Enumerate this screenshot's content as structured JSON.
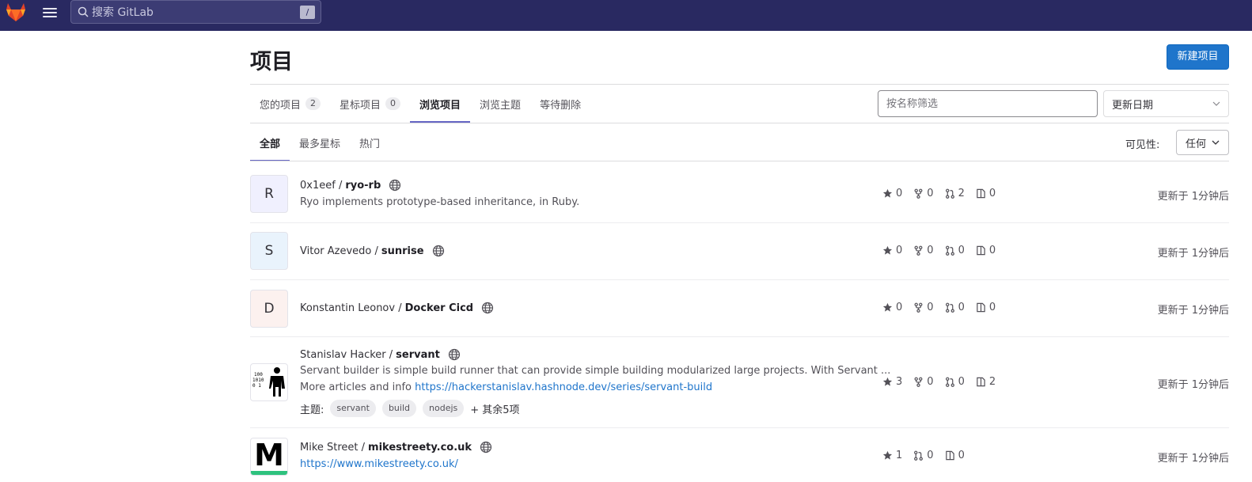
{
  "header": {
    "search_placeholder": "搜索 GitLab",
    "search_shortcut": "/"
  },
  "page": {
    "title": "项目",
    "new_project_label": "新建项目"
  },
  "tabs": [
    {
      "label": "您的项目",
      "count": "2"
    },
    {
      "label": "星标项目",
      "count": "0"
    },
    {
      "label": "浏览项目"
    },
    {
      "label": "浏览主题"
    },
    {
      "label": "等待删除"
    }
  ],
  "filter": {
    "placeholder": "按名称筛选",
    "sort_label": "更新日期"
  },
  "subtabs": [
    "全部",
    "最多星标",
    "热门"
  ],
  "visibility": {
    "label": "可见性:",
    "value": "任何"
  },
  "projects": [
    {
      "avatar": "R",
      "namespace": "0x1eef /",
      "name": "ryo-rb",
      "description": "Ryo implements prototype-based inheritance, in Ruby.",
      "stars": "0",
      "forks": "0",
      "mrs": "2",
      "issues": "0",
      "updated": "更新于 1分钟后"
    },
    {
      "avatar": "S",
      "namespace": "Vitor Azevedo /",
      "name": "sunrise",
      "stars": "0",
      "forks": "0",
      "mrs": "0",
      "issues": "0",
      "updated": "更新于 1分钟后"
    },
    {
      "avatar": "D",
      "namespace": "Konstantin Leonov /",
      "name": "Docker Cicd",
      "stars": "0",
      "forks": "0",
      "mrs": "0",
      "issues": "0",
      "updated": "更新于 1分钟后"
    },
    {
      "namespace": "Stanislav Hacker /",
      "name": "servant",
      "description": "Servant builder is simple build runner that can provide simple building modularized large projects. With Servant ...",
      "desc_more_prefix": "More articles and info",
      "desc_link": "https://hackerstanislav.hashnode.dev/series/servant-build",
      "topics_label": "主题:",
      "topics": [
        "servant",
        "build",
        "nodejs"
      ],
      "topics_more": "+ 其余5项",
      "stars": "3",
      "forks": "0",
      "mrs": "0",
      "issues": "2",
      "updated": "更新于 1分钟后"
    },
    {
      "avatar": "M",
      "namespace": "Mike Street /",
      "name": "mikestreety.co.uk",
      "desc_link": "https://www.mikestreety.co.uk/",
      "stars": "1",
      "mrs": "0",
      "issues": "0",
      "updated": "更新于 1分钟后"
    }
  ],
  "colors": {
    "topbar": "#292961",
    "accent": "#1f75cb",
    "active_tab_underline": "#6666c4"
  }
}
